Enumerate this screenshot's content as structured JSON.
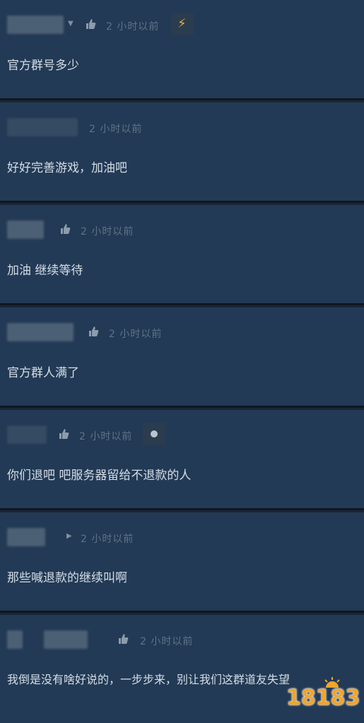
{
  "comments": [
    {
      "time": "2 小时以前",
      "text": "官方群号多少",
      "has_award": true,
      "award": "bolt"
    },
    {
      "time": "2 小时以前",
      "text": "好好完善游戏，加油吧",
      "has_award": false
    },
    {
      "time": "2 小时以前",
      "text": "加油 继续等待",
      "has_award": false
    },
    {
      "time": "2 小时以前",
      "text": "官方群人满了",
      "has_award": false
    },
    {
      "time": "2 小时以前",
      "text": "你们退吧 吧服务器留给不退款的人",
      "has_award": true,
      "award": "dot"
    },
    {
      "time": "2 小时以前",
      "text": "那些喊退款的继续叫啊",
      "has_award": false
    },
    {
      "time": "2 小时以前",
      "text": "我倒是没有啥好说的，一步步来，别让我们这群道友失望",
      "has_award": false
    }
  ],
  "watermark": {
    "text": "18183"
  },
  "colors": {
    "card": "#223a55",
    "separator": "#0f1722",
    "text": "#d5dde6",
    "time": "#5e7387",
    "watermark": "#f1a52a"
  }
}
